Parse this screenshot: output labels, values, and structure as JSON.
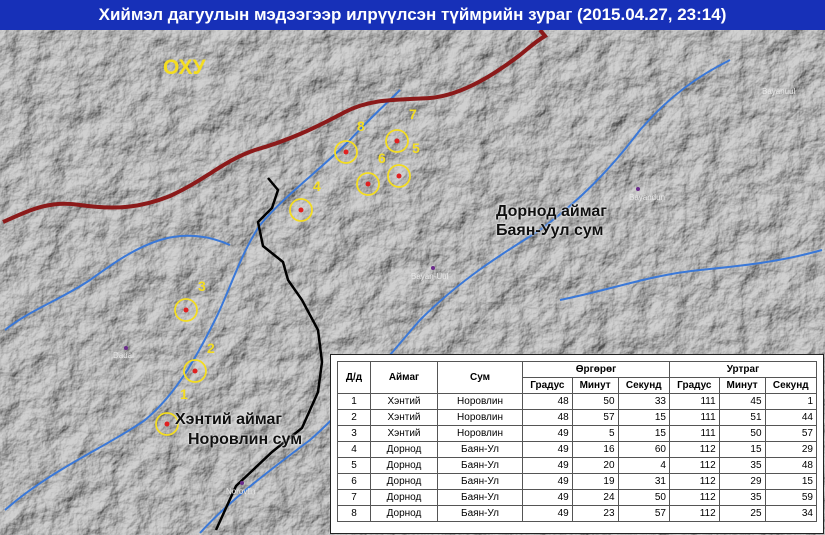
{
  "title": "Хиймэл дагуулын мэдээгээр илрүүлсэн түймрийн зураг  (2015.04.27,  23:14)",
  "labels": {
    "country": "ОХУ",
    "region_dornod_line1": "Дорнод аймаг",
    "region_dornod_line2": "Баян-Уул сум",
    "region_khentii_line1": "Хэнтий аймаг",
    "region_khentii_line2": "Норовлин сум"
  },
  "towns": [
    "Dadal",
    "Norovlin",
    "Bayan-Uul",
    "Bayandun",
    "Bayanuul"
  ],
  "fire_numbers": [
    "1",
    "2",
    "3",
    "4",
    "5",
    "6",
    "7",
    "8"
  ],
  "colors": {
    "title_bar": "#1730b8",
    "border_russia": "#8b1a1a",
    "aimag_border": "#000000",
    "rivers": "#3a78d8",
    "fire_marker": "#e02020",
    "fire_circle": "#f4dd20"
  },
  "table": {
    "headers": {
      "index": "Д/д",
      "aimag": "Аймаг",
      "sum": "Сум",
      "latitude": "Өргөрөг",
      "longitude": "Уртраг",
      "deg": "Градус",
      "min": "Минут",
      "sec": "Секунд"
    },
    "rows": [
      {
        "n": "1",
        "aimag": "Хэнтий",
        "sum": "Норовлин",
        "lat_d": "48",
        "lat_m": "50",
        "lat_s": "33",
        "lon_d": "111",
        "lon_m": "45",
        "lon_s": "1"
      },
      {
        "n": "2",
        "aimag": "Хэнтий",
        "sum": "Норовлин",
        "lat_d": "48",
        "lat_m": "57",
        "lat_s": "15",
        "lon_d": "111",
        "lon_m": "51",
        "lon_s": "44"
      },
      {
        "n": "3",
        "aimag": "Хэнтий",
        "sum": "Норовлин",
        "lat_d": "49",
        "lat_m": "5",
        "lat_s": "15",
        "lon_d": "111",
        "lon_m": "50",
        "lon_s": "57"
      },
      {
        "n": "4",
        "aimag": "Дорнод",
        "sum": "Баян-Ул",
        "lat_d": "49",
        "lat_m": "16",
        "lat_s": "60",
        "lon_d": "112",
        "lon_m": "15",
        "lon_s": "29"
      },
      {
        "n": "5",
        "aimag": "Дорнод",
        "sum": "Баян-Ул",
        "lat_d": "49",
        "lat_m": "20",
        "lat_s": "4",
        "lon_d": "112",
        "lon_m": "35",
        "lon_s": "48"
      },
      {
        "n": "6",
        "aimag": "Дорнод",
        "sum": "Баян-Ул",
        "lat_d": "49",
        "lat_m": "19",
        "lat_s": "31",
        "lon_d": "112",
        "lon_m": "29",
        "lon_s": "15"
      },
      {
        "n": "7",
        "aimag": "Дорнод",
        "sum": "Баян-Ул",
        "lat_d": "49",
        "lat_m": "24",
        "lat_s": "50",
        "lon_d": "112",
        "lon_m": "35",
        "lon_s": "59"
      },
      {
        "n": "8",
        "aimag": "Дорнод",
        "sum": "Баян-Ул",
        "lat_d": "49",
        "lat_m": "23",
        "lat_s": "57",
        "lon_d": "112",
        "lon_m": "25",
        "lon_s": "34"
      }
    ]
  }
}
